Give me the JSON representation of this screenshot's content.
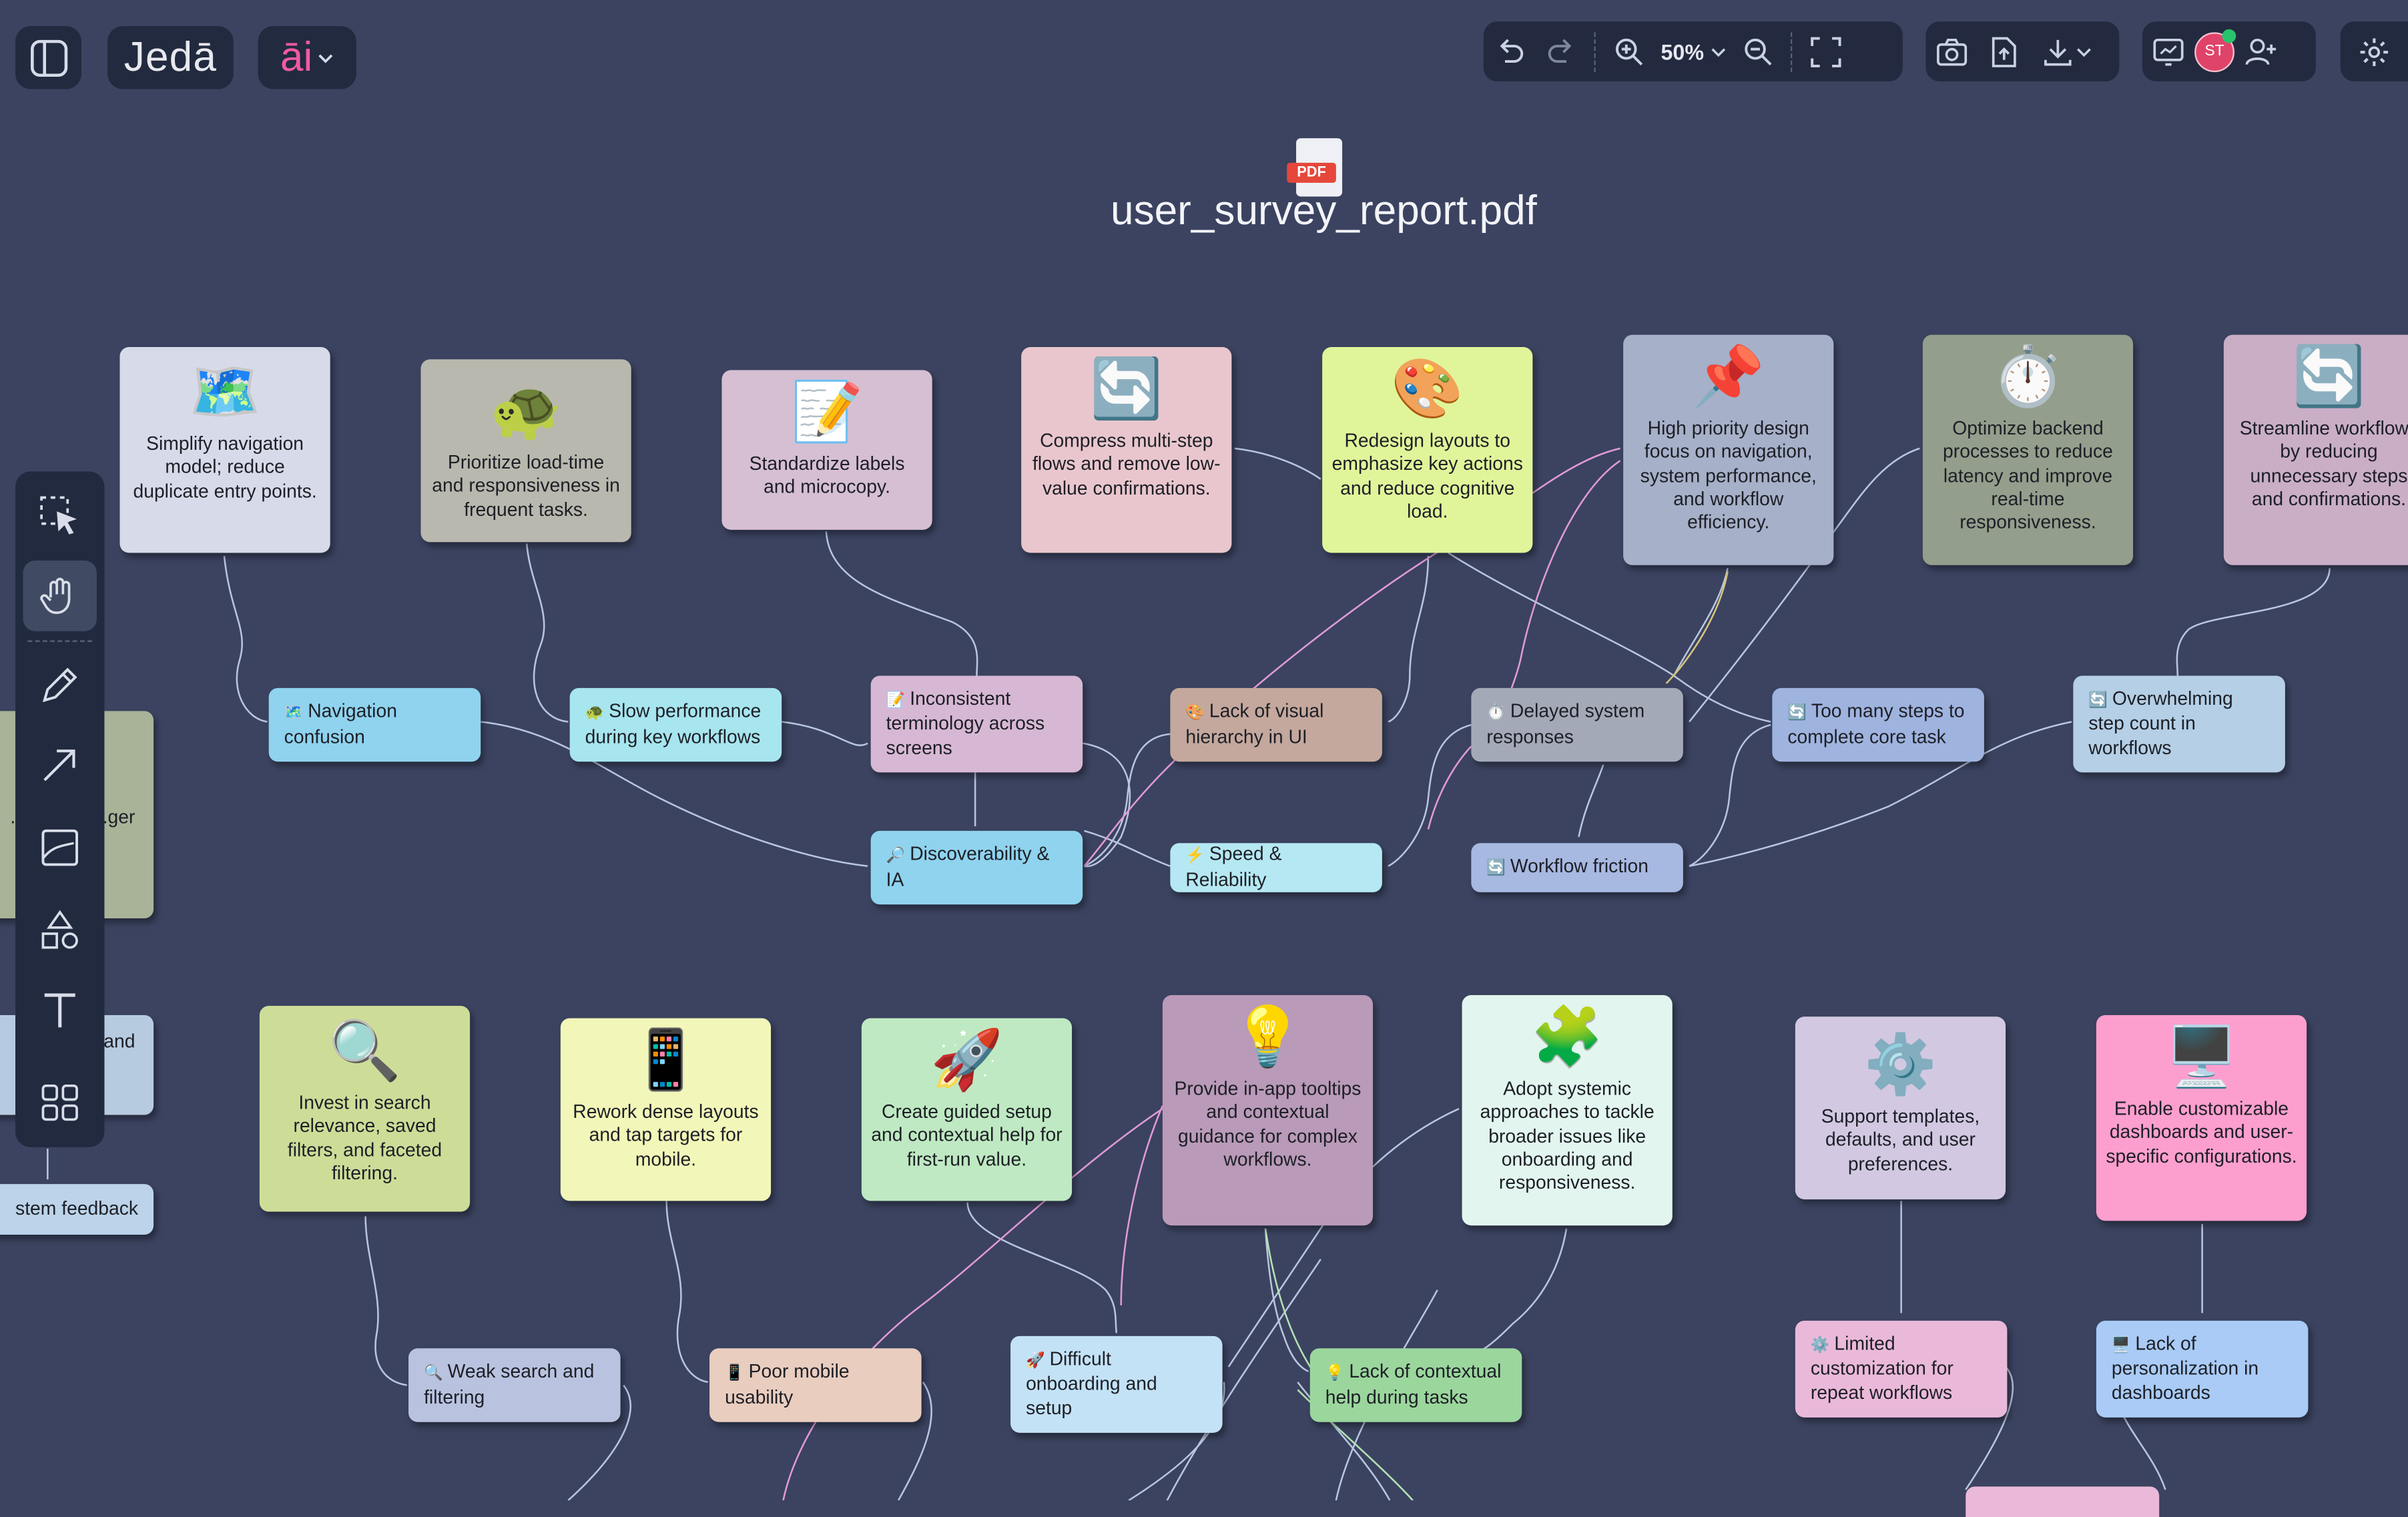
{
  "app": {
    "logo": "Jedā",
    "ai_label": "āi",
    "zoom": "50%",
    "avatar_initials": "ST"
  },
  "document": {
    "title": "user_survey_report.pdf",
    "file_badge": "PDF"
  },
  "solutions": [
    {
      "emoji": "🗺️",
      "text": "Simplify navigation model; reduce duplicate entry points.",
      "color": "#d7dbe9"
    },
    {
      "emoji": "🐢",
      "text": "Prioritize load-time and responsiveness in frequent tasks.",
      "color": "#b9b8ae"
    },
    {
      "emoji": "📝",
      "text": "Standardize labels and microcopy.",
      "color": "#d6bfd2"
    },
    {
      "emoji": "🔄",
      "text": "Compress multi-step flows and remove low-value confirmations.",
      "color": "#e9c6cd"
    },
    {
      "emoji": "🎨",
      "text": "Redesign layouts to emphasize key actions and reduce cognitive load.",
      "color": "#e0f59a"
    },
    {
      "emoji": "📌",
      "text": "High priority design focus on navigation, system performance, and workflow efficiency.",
      "color": "#a6b0c8"
    },
    {
      "emoji": "⏱️",
      "text": "Optimize backend processes to reduce latency and improve real-time responsiveness.",
      "color": "#939e8c"
    },
    {
      "emoji": "🔄",
      "text": "Streamline workflows by reducing unnecessary steps and confirmations.",
      "color": "#c9aec6"
    },
    {
      "emoji": "🔍",
      "text": "Invest in search relevance, saved filters, and faceted filtering.",
      "color": "#cddd98"
    },
    {
      "emoji": "📱",
      "text": "Rework dense layouts and tap targets for mobile.",
      "color": "#f2f6b8"
    },
    {
      "emoji": "🚀",
      "text": "Create guided setup and contextual help for first-run value.",
      "color": "#bfe9c2"
    },
    {
      "emoji": "💡",
      "text": "Provide in-app tooltips and contextual guidance for complex workflows.",
      "color": "#b99ab8"
    },
    {
      "emoji": "🧩",
      "text": "Adopt systemic approaches to tackle broader issues like onboarding and responsiveness.",
      "color": "#e2f5ee"
    },
    {
      "emoji": "⚙️",
      "text": "Support templates, defaults, and user preferences.",
      "color": "#d2c8e2"
    },
    {
      "emoji": "🖥️",
      "text": "Enable customizable dashboards and user-specific configurations.",
      "color": "#fd9fce"
    }
  ],
  "problems": [
    {
      "emoji": "🗺️",
      "text": "Navigation confusion",
      "color": "#8fd3ee"
    },
    {
      "emoji": "🐢",
      "text": "Slow performance during key workflows",
      "color": "#a7e5ef"
    },
    {
      "emoji": "📝",
      "text": "Inconsistent terminology across screens",
      "color": "#d7b8d4"
    },
    {
      "emoji": "🎨",
      "text": "Lack of visual hierarchy in UI",
      "color": "#c4a89d"
    },
    {
      "emoji": "⏱️",
      "text": "Delayed system responses",
      "color": "#a4a9b8"
    },
    {
      "emoji": "🔄",
      "text": "Too many steps to complete core task",
      "color": "#9fb3df"
    },
    {
      "emoji": "🔄",
      "text": "Overwhelming step count in workflows",
      "color": "#b4cfe6"
    },
    {
      "emoji": "🔍",
      "text": "Weak search and filtering",
      "color": "#b9c2df"
    },
    {
      "emoji": "📱",
      "text": "Poor mobile usability",
      "color": "#e9cdbf"
    },
    {
      "emoji": "🚀",
      "text": "Difficult onboarding and setup",
      "color": "#c4e2f6"
    },
    {
      "emoji": "💡",
      "text": "Lack of contextual help during tasks",
      "color": "#9bd69d"
    },
    {
      "emoji": "⚙️",
      "text": "Limited customization for repeat workflows",
      "color": "#eab9d9"
    },
    {
      "emoji": "🖥️",
      "text": "Lack of personalization in dashboards",
      "color": "#a9cbf6"
    }
  ],
  "themes": [
    {
      "emoji": "🔎",
      "text": "Discoverability & IA",
      "color": "#8fd3ee"
    },
    {
      "emoji": "⚡",
      "text": "Speed & Reliability",
      "color": "#b5e8f2"
    },
    {
      "emoji": "🔄",
      "text": "Workflow friction",
      "color": "#a7b8e1"
    }
  ],
  "partial_left": [
    {
      "text": "...e ...ess ...ger",
      "color": "#a8b398"
    },
    {
      "text": "...and",
      "color": "#b7cbe0"
    },
    {
      "text": "stem feedback",
      "color": "#bcd3e9"
    }
  ]
}
